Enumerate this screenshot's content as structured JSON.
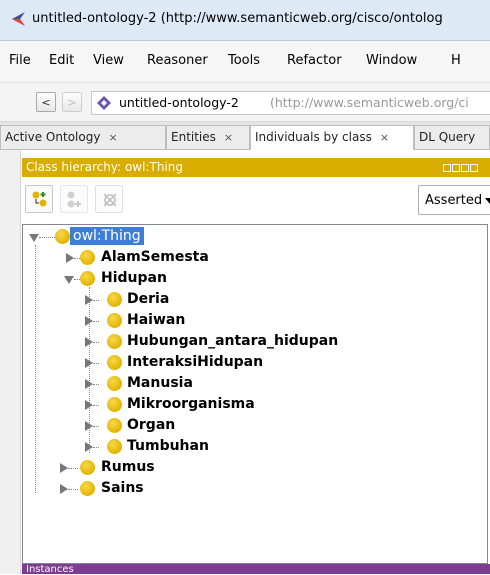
{
  "window": {
    "title": "untitled-ontology-2 (http://www.semanticweb.org/cisco/ontolog"
  },
  "menu": [
    "File",
    "Edit",
    "View",
    "Reasoner",
    "Tools",
    "Refactor",
    "Window",
    "H"
  ],
  "address": {
    "back_label": "<",
    "forward_label": ">",
    "ontology_name": "untitled-ontology-2",
    "ontology_uri": "(http://www.semanticweb.org/ci"
  },
  "tabs": [
    {
      "label": "Active Ontology",
      "close": "×"
    },
    {
      "label": "Entities",
      "close": "×"
    },
    {
      "label": "Individuals by class",
      "close": "×"
    },
    {
      "label": "DL Query",
      "close": ""
    }
  ],
  "view": {
    "title": "Class hierarchy: owl:Thing",
    "select_value": "Asserted",
    "colors": {
      "header": "#d9ad00",
      "selection": "#3d7fd6",
      "node": "#e2b300"
    }
  },
  "tree": {
    "root": "owl:Thing",
    "level1": [
      {
        "label": "AlamSemesta",
        "state": "collapsed"
      },
      {
        "label": "Hidupan",
        "state": "expanded"
      },
      {
        "label": "Rumus",
        "state": "collapsed"
      },
      {
        "label": "Sains",
        "state": "collapsed"
      }
    ],
    "hidupan_children": [
      "Deria",
      "Haiwan",
      "Hubungan_antara_hidupan",
      "InteraksiHidupan",
      "Manusia",
      "Mikroorganisma",
      "Organ",
      "Tumbuhan"
    ]
  },
  "bottom_view": {
    "title": "Instances"
  }
}
